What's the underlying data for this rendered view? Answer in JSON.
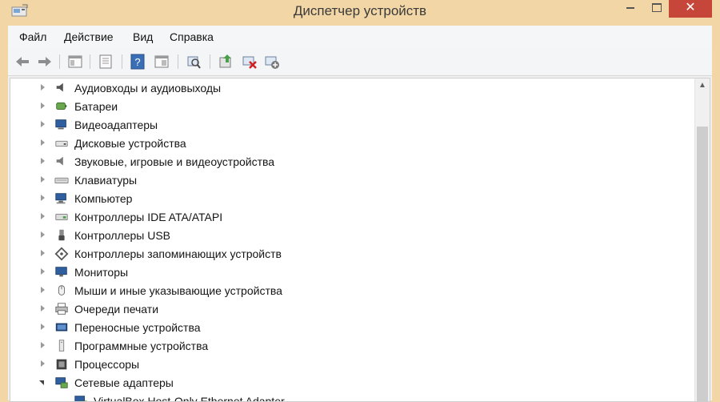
{
  "window": {
    "title": "Диспетчер устройств",
    "close_symbol": "✕",
    "accent_close": "#c7463a"
  },
  "menu": {
    "file": "Файл",
    "action": "Действие",
    "view": "Вид",
    "help": "Справка"
  },
  "toolbar": {
    "icons": [
      "back-arrow-icon",
      "forward-arrow-icon",
      "properties-view-icon",
      "window-icon",
      "help-icon",
      "properties-icon",
      "scan-hardware-icon",
      "update-driver-icon",
      "disable-device-icon",
      "uninstall-device-icon"
    ]
  },
  "tree": {
    "items": [
      {
        "label": "Аудиовходы и аудиовыходы",
        "icon": "speaker-icon"
      },
      {
        "label": "Батареи",
        "icon": "battery-icon"
      },
      {
        "label": "Видеоадаптеры",
        "icon": "display-adapter-icon"
      },
      {
        "label": "Дисковые устройства",
        "icon": "disk-drive-icon"
      },
      {
        "label": "Звуковые, игровые и видеоустройства",
        "icon": "sound-icon"
      },
      {
        "label": "Клавиатуры",
        "icon": "keyboard-icon"
      },
      {
        "label": "Компьютер",
        "icon": "computer-icon"
      },
      {
        "label": "Контроллеры IDE ATA/ATAPI",
        "icon": "ide-controller-icon"
      },
      {
        "label": "Контроллеры USB",
        "icon": "usb-icon"
      },
      {
        "label": "Контроллеры запоминающих устройств",
        "icon": "storage-controller-icon"
      },
      {
        "label": "Мониторы",
        "icon": "monitor-icon"
      },
      {
        "label": "Мыши и иные указывающие устройства",
        "icon": "mouse-icon"
      },
      {
        "label": "Очереди печати",
        "icon": "printer-icon"
      },
      {
        "label": "Переносные устройства",
        "icon": "portable-device-icon"
      },
      {
        "label": "Программные устройства",
        "icon": "software-device-icon"
      },
      {
        "label": "Процессоры",
        "icon": "processor-icon"
      },
      {
        "label": "Сетевые адаптеры",
        "icon": "network-adapter-icon",
        "expanded": true
      },
      {
        "label": "VirtualBox Host-Only Ethernet Adapter",
        "icon": "network-card-icon",
        "child": true
      }
    ]
  }
}
